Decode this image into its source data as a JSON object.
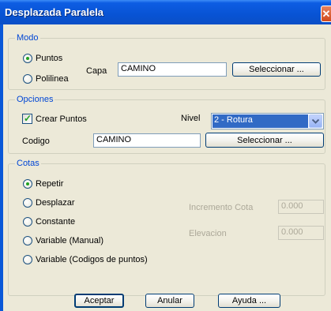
{
  "window": {
    "title": "Desplazada Paralela",
    "close_glyph": "✕"
  },
  "modo": {
    "legend": "Modo",
    "puntos_label": "Puntos",
    "polilinea_label": "Polilinea",
    "selected": "Puntos",
    "capa_label": "Capa",
    "capa_value": "CAMINO",
    "seleccionar_label": "Seleccionar ..."
  },
  "opciones": {
    "legend": "Opciones",
    "crear_puntos_label": "Crear Puntos",
    "crear_puntos_checked": true,
    "nivel_label": "Nivel",
    "nivel_value": "2 - Rotura",
    "codigo_label": "Codigo",
    "codigo_value": "CAMINO",
    "seleccionar_label": "Seleccionar ..."
  },
  "cotas": {
    "legend": "Cotas",
    "options": [
      "Repetir",
      "Desplazar",
      "Constante",
      "Variable (Manual)",
      "Variable (Codigos de puntos)"
    ],
    "selected": "Repetir",
    "incremento_label": "Incremento Cota",
    "incremento_value": "0.000",
    "elevacion_label": "Elevacion",
    "elevacion_value": "0.000"
  },
  "buttons": {
    "aceptar": "Aceptar",
    "anular": "Anular",
    "ayuda": "Ayuda ..."
  },
  "colors": {
    "title_bar": "#0853d4",
    "dialog_bg": "#ece9d8",
    "legend_text": "#0046d5",
    "selection": "#316ac5"
  },
  "icons": {
    "close": "close-icon",
    "dropdown": "chevron-down-icon",
    "check": "check-icon"
  }
}
